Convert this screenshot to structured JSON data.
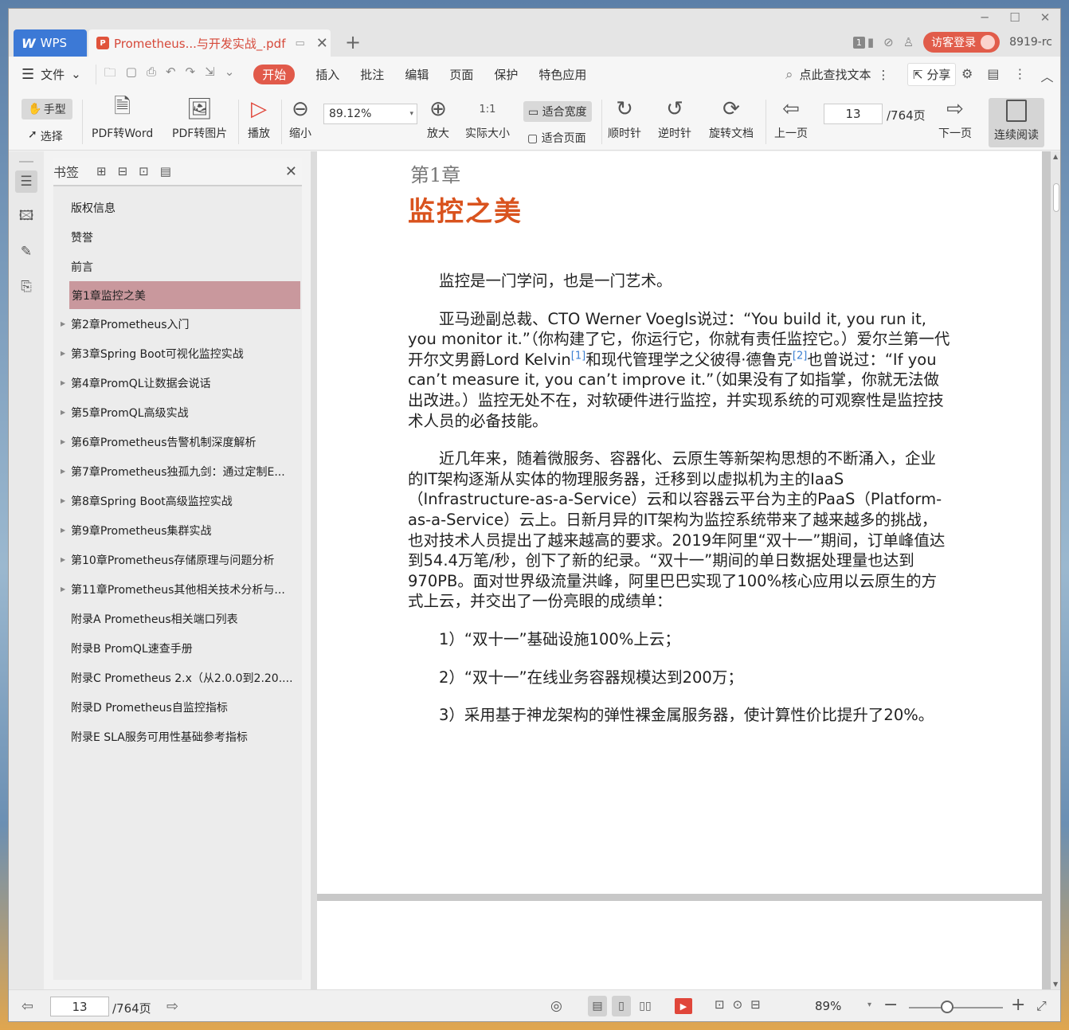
{
  "window": {
    "controls": {
      "minimize": "─",
      "maximize": "☐",
      "close": "✕"
    }
  },
  "tabs": {
    "wps": {
      "logo": "W",
      "label": "WPS"
    },
    "document": {
      "badge": "P",
      "title": "Prometheus...与开发实战_.pdf",
      "close": "✕"
    },
    "add": "+"
  },
  "title_right": {
    "page_indicator": "1",
    "visitor_login": "访客登录",
    "version": "8919-rc"
  },
  "menubar": {
    "file": "文件",
    "tabs": [
      "开始",
      "插入",
      "批注",
      "编辑",
      "页面",
      "保护",
      "特色应用"
    ],
    "active_tab": "开始",
    "search_text": "点此查找文本",
    "share": "分享"
  },
  "toolbar": {
    "hand": "手型",
    "select": "选择",
    "pdf_to_word": "PDF转Word",
    "pdf_to_image": "PDF转图片",
    "play": "播放",
    "zoom_out": "缩小",
    "zoom_value": "89.12%",
    "zoom_in": "放大",
    "actual_size": "实际大小",
    "actual_size_icon": "1:1",
    "fit_width": "适合宽度",
    "fit_page": "适合页面",
    "rotate_cw": "顺时针",
    "rotate_ccw": "逆时针",
    "rotate_doc": "旋转文档",
    "prev_page": "上一页",
    "current_page": "13",
    "total_pages": "/764页",
    "next_page": "下一页",
    "continuous_read": "连续阅读"
  },
  "bookmarks": {
    "title": "书签",
    "items": [
      {
        "label": "版权信息",
        "expandable": false
      },
      {
        "label": "赞誉",
        "expandable": false
      },
      {
        "label": "前言",
        "expandable": false
      },
      {
        "label": "第1章监控之美",
        "expandable": true,
        "active": true
      },
      {
        "label": "第2章Prometheus入门",
        "expandable": true
      },
      {
        "label": "第3章Spring Boot可视化监控实战",
        "expandable": true
      },
      {
        "label": "第4章PromQL让数据会说话",
        "expandable": true
      },
      {
        "label": "第5章PromQL高级实战",
        "expandable": true
      },
      {
        "label": "第6章Prometheus告警机制深度解析",
        "expandable": true
      },
      {
        "label": "第7章Prometheus独孤九剑：通过定制E...",
        "expandable": true
      },
      {
        "label": "第8章Spring Boot高级监控实战",
        "expandable": true
      },
      {
        "label": "第9章Prometheus集群实战",
        "expandable": true
      },
      {
        "label": "第10章Prometheus存储原理与问题分析",
        "expandable": true
      },
      {
        "label": "第11章Prometheus其他相关技术分析与...",
        "expandable": true
      },
      {
        "label": "附录A Prometheus相关端口列表",
        "expandable": false
      },
      {
        "label": "附录B PromQL速查手册",
        "expandable": false
      },
      {
        "label": "附录C Prometheus 2.x（从2.0.0到2.20....",
        "expandable": false
      },
      {
        "label": "附录D Prometheus自监控指标",
        "expandable": false
      },
      {
        "label": "附录E SLA服务可用性基础参考指标",
        "expandable": false
      }
    ]
  },
  "document": {
    "chapter_num": "第1章",
    "chapter_title": "监控之美",
    "p1": "监控是一门学问，也是一门艺术。",
    "p2_a": "亚马逊副总裁、CTO Werner Voegls说过：“You build it, you run it, you monitor it.”（你构建了它，你运行它，你就有责任监控它。）爱尔兰第一代开尔文男爵Lord Kelvin",
    "fn1": "[1]",
    "p2_b": "和现代管理学之父彼得·德鲁克",
    "fn2": "[2]",
    "p2_c": "也曾说过：“If you can’t measure it, you can’t improve it.”（如果没有了如指掌，你就无法做出改进。）监控无处不在，对软硬件进行监控，并实现系统的可观察性是监控技术人员的必备技能。",
    "p3": "近几年来，随着微服务、容器化、云原生等新架构思想的不断涌入，企业的IT架构逐渐从实体的物理服务器，迁移到以虚拟机为主的IaaS（Infrastructure-as-a-Service）云和以容器云平台为主的PaaS（Platform-as-a-Service）云上。日新月异的IT架构为监控系统带来了越来越多的挑战，也对技术人员提出了越来越高的要求。2019年阿里“双十一”期间，订单峰值达到54.4万笔/秒，创下了新的纪录。“双十一”期间的单日数据处理量也达到970PB。面对世界级流量洪峰，阿里巴巴实现了100%核心应用以云原生的方式上云，并交出了一份亮眼的成绩单：",
    "li1": "1）“双十一”基础设施100%上云；",
    "li2": "2）“双十一”在线业务容器规模达到200万；",
    "li3": "3）采用基于神龙架构的弹性裸金属服务器，使计算性价比提升了20%。"
  },
  "statusbar": {
    "current_page": "13",
    "total_pages": "/764页",
    "zoom": "89%"
  },
  "colors": {
    "accent": "#e15a4a",
    "chapter_title": "#d9531e",
    "active_bookmark": "#c9989d",
    "wps_blue": "#3c79d6"
  }
}
